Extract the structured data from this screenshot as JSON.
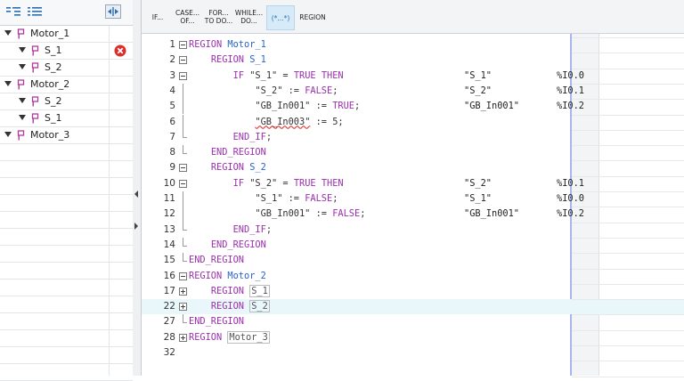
{
  "tree": {
    "items": [
      {
        "label": "Motor_1",
        "level": 0,
        "error": false
      },
      {
        "label": "S_1",
        "level": 1,
        "error": true
      },
      {
        "label": "S_2",
        "level": 1,
        "error": false
      },
      {
        "label": "Motor_2",
        "level": 0,
        "error": false
      },
      {
        "label": "S_2",
        "level": 1,
        "error": false
      },
      {
        "label": "S_1",
        "level": 1,
        "error": false
      },
      {
        "label": "Motor_3",
        "level": 0,
        "error": false
      }
    ]
  },
  "toolbar": {
    "buttons": [
      {
        "label": "IF...",
        "selected": false
      },
      {
        "label": "CASE... OF...",
        "selected": false
      },
      {
        "label": "FOR... TO DO...",
        "selected": false
      },
      {
        "label": "WHILE... DO...",
        "selected": false
      },
      {
        "label": "(*...*)",
        "selected": true
      },
      {
        "label": "REGION",
        "selected": false
      }
    ]
  },
  "code": {
    "lines": [
      {
        "no": "1",
        "fold": "minus",
        "text": "REGION Motor_1"
      },
      {
        "no": "2",
        "fold": "minus",
        "text": "    REGION S_1"
      },
      {
        "no": "3",
        "fold": "minus",
        "text": "        IF \"S_1\" = TRUE THEN",
        "tag": "\"S_1\"",
        "addr": "%I0.0"
      },
      {
        "no": "4",
        "fold": "",
        "text": "            \"S_2\" := FALSE;",
        "tag": "\"S_2\"",
        "addr": "%I0.1"
      },
      {
        "no": "5",
        "fold": "",
        "text": "            \"GB_In001\" := TRUE;",
        "tag": "\"GB_In001\"",
        "addr": "%I0.2"
      },
      {
        "no": "6",
        "fold": "",
        "text": "            \"GB_In003\" := 5;"
      },
      {
        "no": "7",
        "fold": "",
        "text": "        END_IF;"
      },
      {
        "no": "8",
        "fold": "",
        "text": "    END_REGION"
      },
      {
        "no": "9",
        "fold": "minus",
        "text": "    REGION S_2"
      },
      {
        "no": "10",
        "fold": "minus",
        "text": "        IF \"S_2\" = TRUE THEN",
        "tag": "\"S_2\"",
        "addr": "%I0.1"
      },
      {
        "no": "11",
        "fold": "",
        "text": "            \"S_1\" := FALSE;",
        "tag": "\"S_1\"",
        "addr": "%I0.0"
      },
      {
        "no": "12",
        "fold": "",
        "text": "            \"GB_In001\" := FALSE;",
        "tag": "\"GB_In001\"",
        "addr": "%I0.2"
      },
      {
        "no": "13",
        "fold": "",
        "text": "        END_IF;"
      },
      {
        "no": "14",
        "fold": "",
        "text": "    END_REGION"
      },
      {
        "no": "15",
        "fold": "",
        "text": "END_REGION"
      },
      {
        "no": "16",
        "fold": "minus",
        "text": "REGION Motor_2"
      },
      {
        "no": "17",
        "fold": "plus",
        "text": "    REGION S_1"
      },
      {
        "no": "22",
        "fold": "plus",
        "text": "    REGION S_2"
      },
      {
        "no": "27",
        "fold": "",
        "text": "END_REGION"
      },
      {
        "no": "28",
        "fold": "plus",
        "text": "REGION Motor_3"
      },
      {
        "no": "32",
        "fold": "",
        "text": ""
      }
    ]
  },
  "colors": {
    "keyword": "#9b2fae",
    "region_name": "#2563c9",
    "selection": "#d6eaf8",
    "current_line": "#eaf7fa",
    "error": "#d9302c"
  }
}
